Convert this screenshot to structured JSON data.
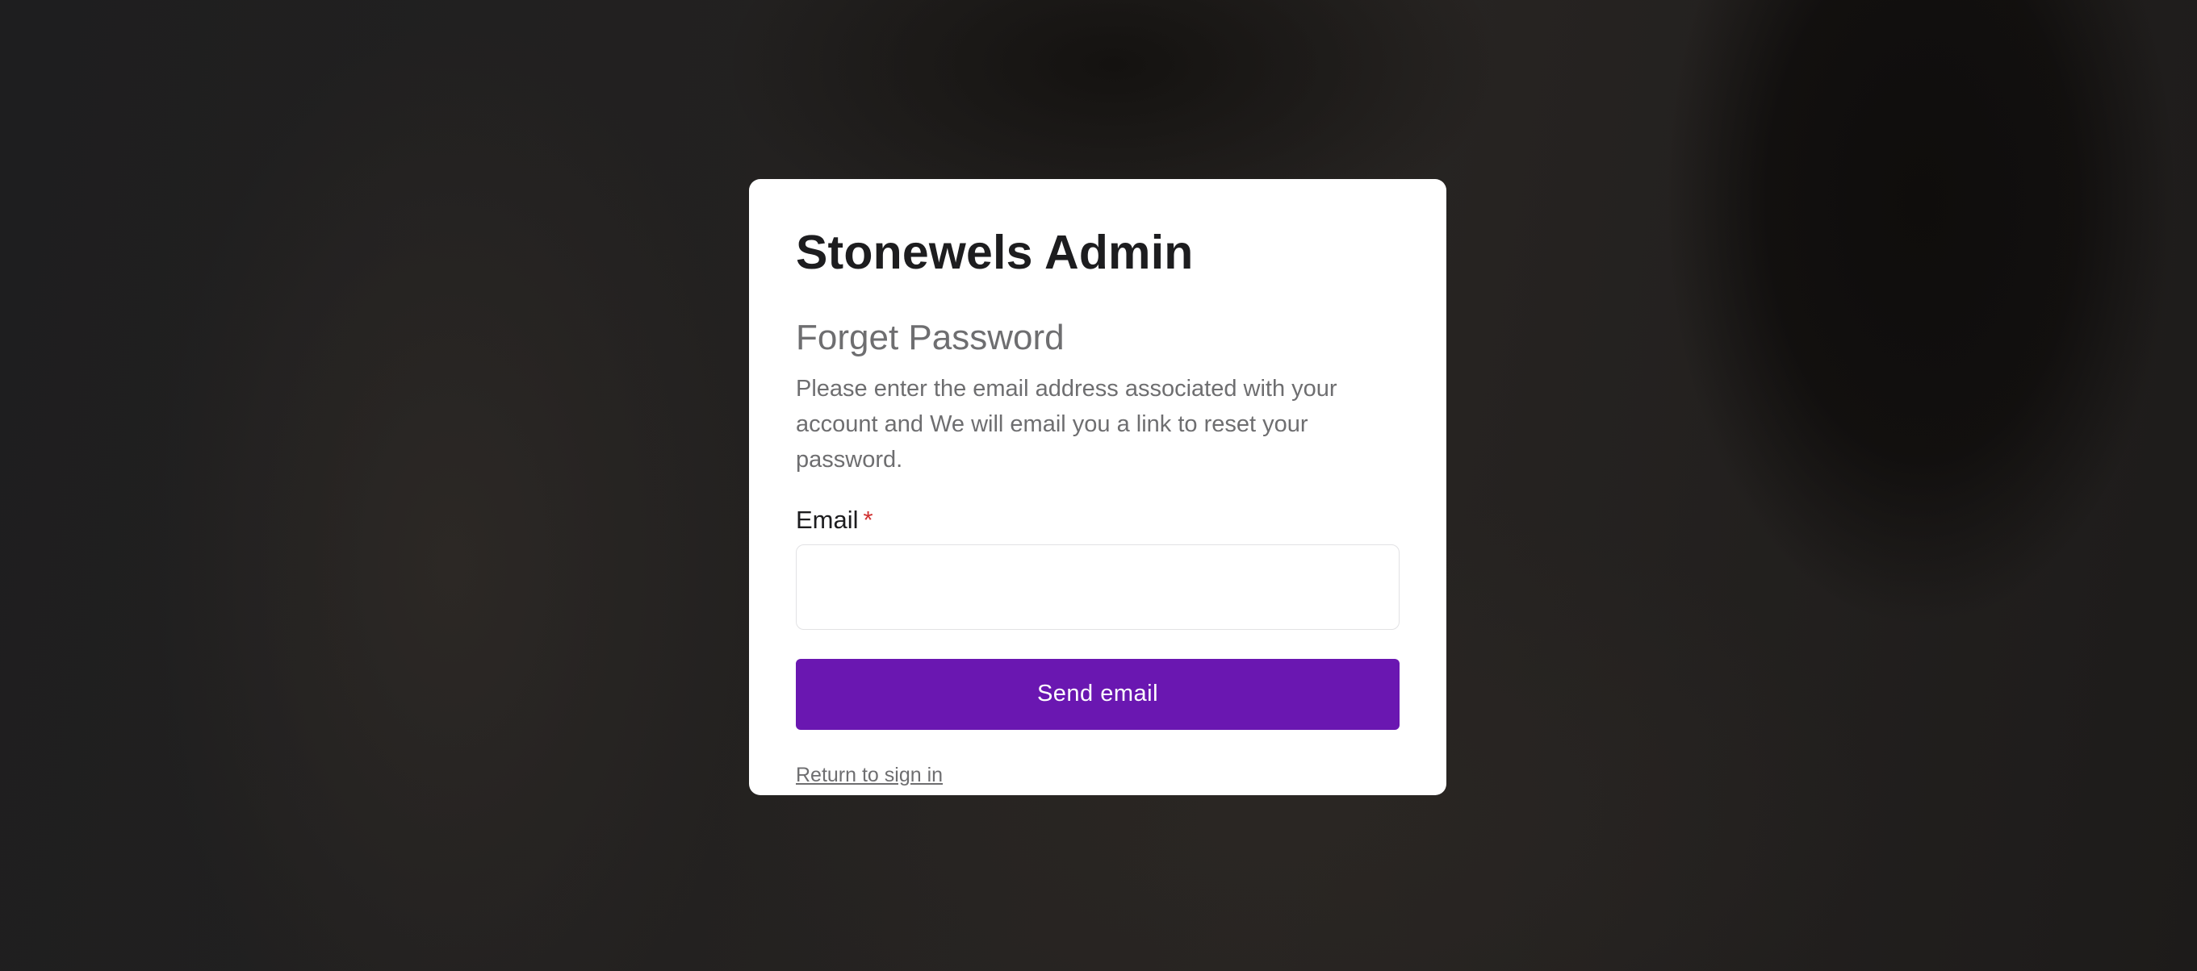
{
  "app": {
    "title": "Stonewels Admin"
  },
  "form": {
    "heading": "Forget Password",
    "description": "Please enter the email address associated with your account and We will email you a link to reset your password.",
    "email_label": "Email",
    "required_marker": "*",
    "email_value": "",
    "email_placeholder": "",
    "submit_label": "Send email",
    "return_link_label": "Return to sign in"
  },
  "colors": {
    "accent": "#6a17b1",
    "required": "#d03030",
    "text_primary": "#1d1d1f",
    "text_secondary": "#6e6e70"
  }
}
